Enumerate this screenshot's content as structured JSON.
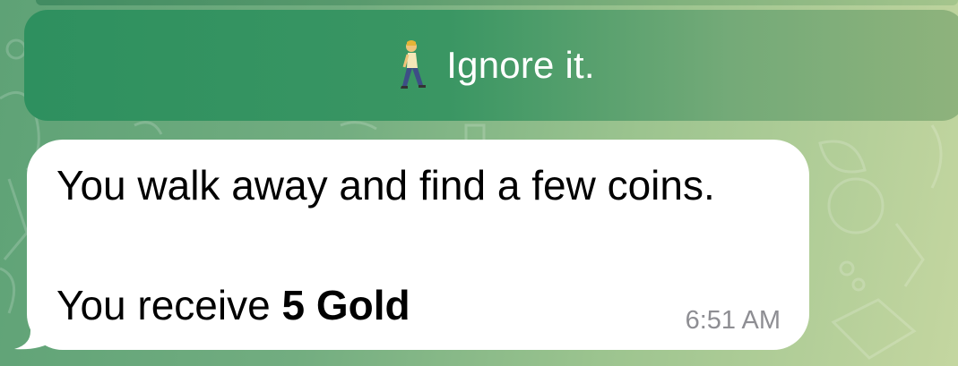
{
  "inline_button": {
    "icon": "person-walking-icon",
    "label": "Ignore it."
  },
  "message": {
    "line1": "You walk away and find a few coins.",
    "line2_prefix": "You receive ",
    "line2_bold": "5 Gold",
    "time": "6:51 AM"
  },
  "colors": {
    "button_green": "#2e905f",
    "bubble_bg": "#ffffff",
    "timestamp_gray": "#8e8e93"
  }
}
